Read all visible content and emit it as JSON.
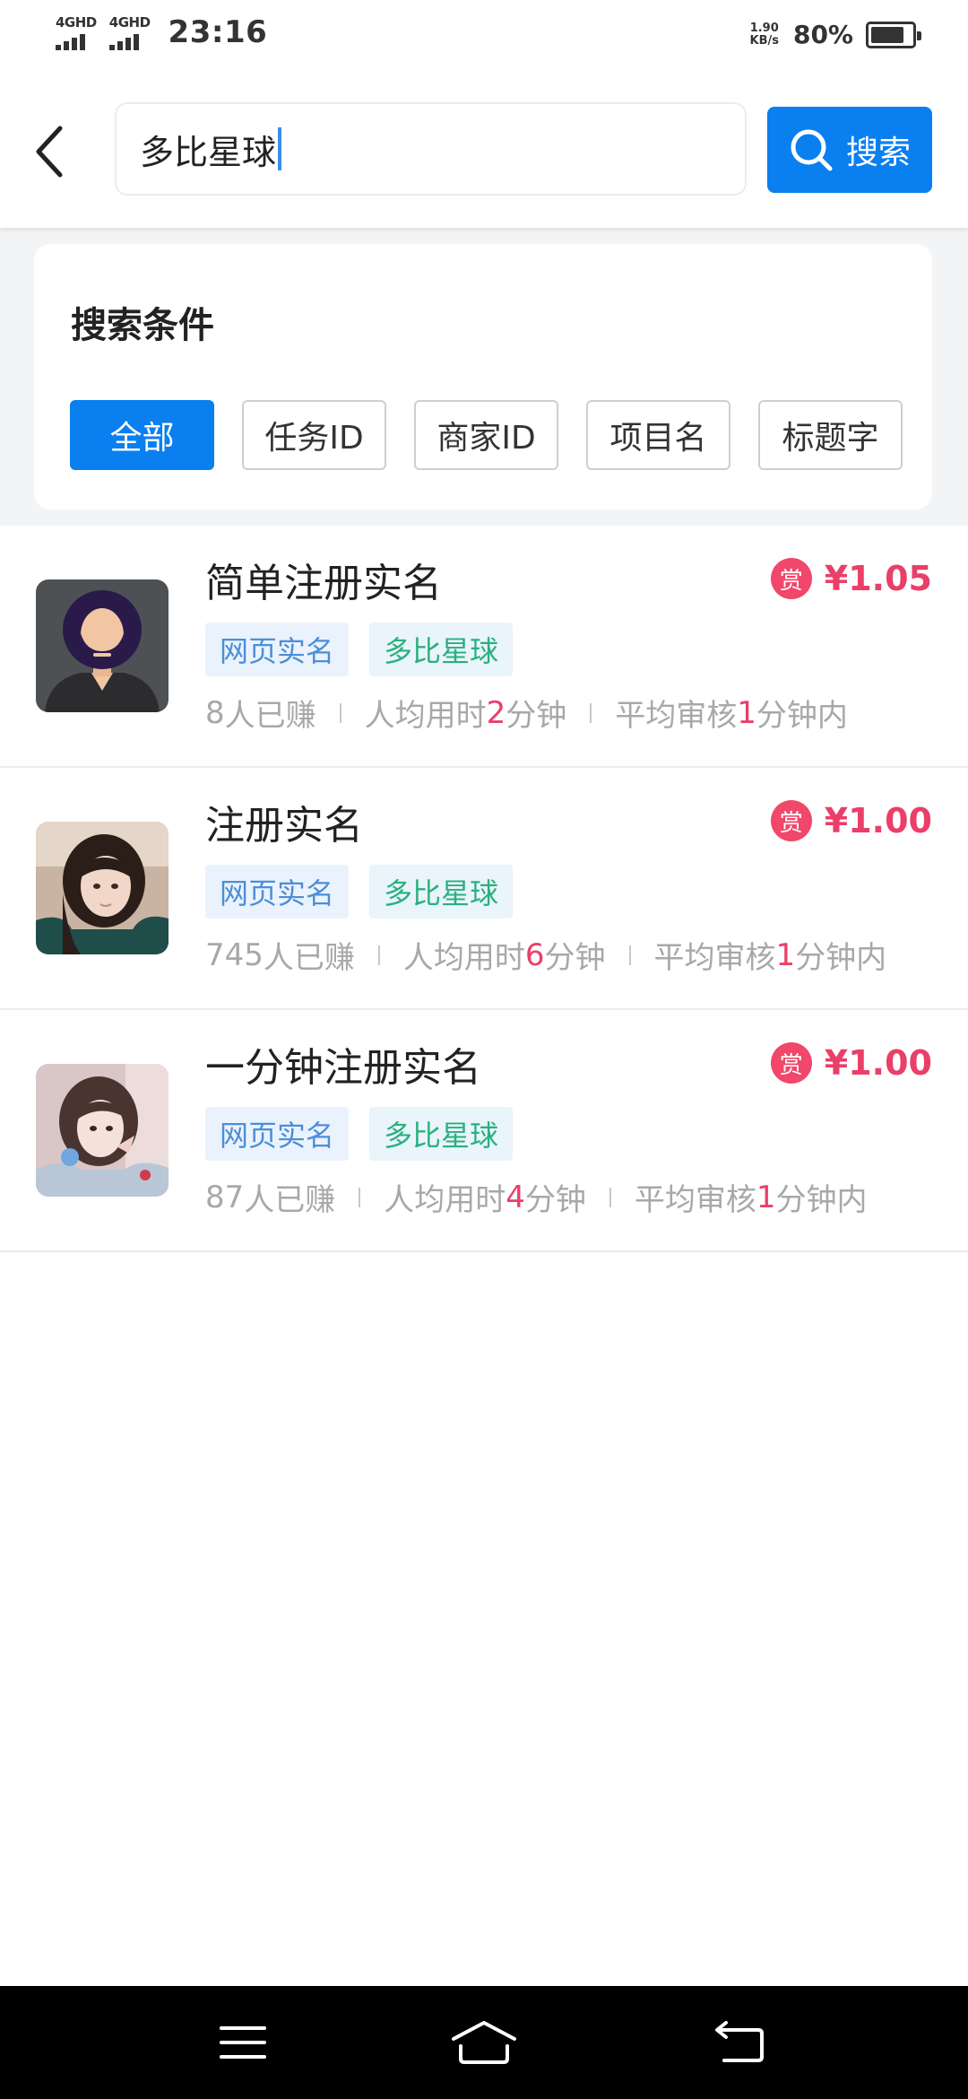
{
  "status_bar": {
    "signal1": "4GHD",
    "signal2": "4GHD",
    "time": "23:16",
    "net_speed_value": "1.90",
    "net_speed_unit": "KB/s",
    "battery_percent": "80%"
  },
  "header": {
    "search_value": "多比星球",
    "search_button_label": "搜索"
  },
  "filters": {
    "title": "搜索条件",
    "options": [
      {
        "label": "全部",
        "active": true
      },
      {
        "label": "任务ID",
        "active": false
      },
      {
        "label": "商家ID",
        "active": false
      },
      {
        "label": "项目名",
        "active": false
      },
      {
        "label": "标题字",
        "active": false
      }
    ]
  },
  "tasks": [
    {
      "title": "简单注册实名",
      "reward_badge": "赏",
      "price": "¥1.05",
      "tags": [
        "网页实名",
        "多比星球"
      ],
      "earned_count": "8",
      "earned_suffix": "人已赚",
      "avg_time_prefix": "人均用时",
      "avg_time_value": "2",
      "avg_time_suffix": "分钟",
      "review_prefix": "平均审核",
      "review_value": "1",
      "review_suffix": "分钟内"
    },
    {
      "title": "注册实名",
      "reward_badge": "赏",
      "price": "¥1.00",
      "tags": [
        "网页实名",
        "多比星球"
      ],
      "earned_count": "745",
      "earned_suffix": "人已赚",
      "avg_time_prefix": "人均用时",
      "avg_time_value": "6",
      "avg_time_suffix": "分钟",
      "review_prefix": "平均审核",
      "review_value": "1",
      "review_suffix": "分钟内"
    },
    {
      "title": "一分钟注册实名",
      "reward_badge": "赏",
      "price": "¥1.00",
      "tags": [
        "网页实名",
        "多比星球"
      ],
      "earned_count": "87",
      "earned_suffix": "人已赚",
      "avg_time_prefix": "人均用时",
      "avg_time_value": "4",
      "avg_time_suffix": "分钟",
      "review_prefix": "平均审核",
      "review_value": "1",
      "review_suffix": "分钟内"
    }
  ],
  "colors": {
    "primary": "#0a7ff0",
    "price": "#ea3f68",
    "tag_blue": "#4d8ed6",
    "tag_green": "#2ab07e"
  },
  "icons": {
    "back": "chevron-left-icon",
    "search": "search-icon",
    "nav_menu": "menu-icon",
    "nav_home": "home-icon",
    "nav_back": "return-icon"
  }
}
